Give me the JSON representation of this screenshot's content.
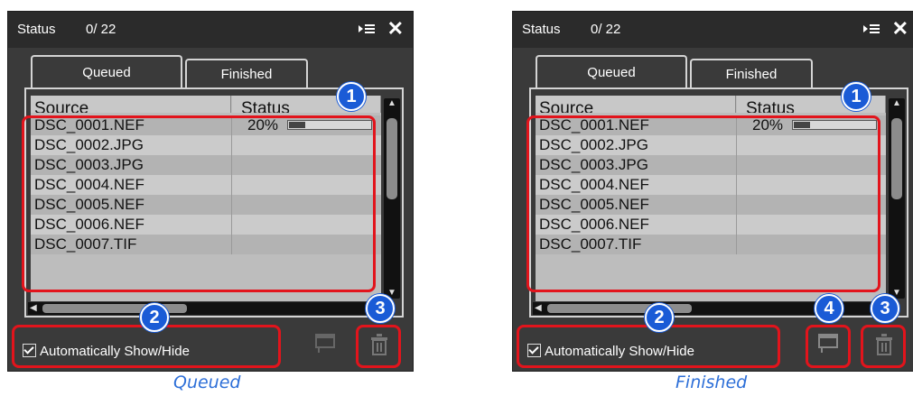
{
  "panels": [
    {
      "title": "Status",
      "count": "0/ 22",
      "tabs": {
        "queued": "Queued",
        "finished": "Finished"
      },
      "columns": {
        "source": "Source",
        "status": "Status"
      },
      "rows": [
        {
          "source": "DSC_0001.NEF",
          "status": "20%",
          "progress": 0.2
        },
        {
          "source": "DSC_0002.JPG",
          "status": ""
        },
        {
          "source": "DSC_0003.JPG",
          "status": ""
        },
        {
          "source": "DSC_0004.NEF",
          "status": ""
        },
        {
          "source": "DSC_0005.NEF",
          "status": ""
        },
        {
          "source": "DSC_0006.NEF",
          "status": ""
        },
        {
          "source": "DSC_0007.TIF",
          "status": ""
        }
      ],
      "checkbox_label": "Automatically Show/Hide",
      "caption": "Queued",
      "badges": [
        "1",
        "2",
        "3"
      ]
    },
    {
      "title": "Status",
      "count": "0/ 22",
      "tabs": {
        "queued": "Queued",
        "finished": "Finished"
      },
      "columns": {
        "source": "Source",
        "status": "Status"
      },
      "rows": [
        {
          "source": "DSC_0001.NEF",
          "status": "20%",
          "progress": 0.2
        },
        {
          "source": "DSC_0002.JPG",
          "status": ""
        },
        {
          "source": "DSC_0003.JPG",
          "status": ""
        },
        {
          "source": "DSC_0004.NEF",
          "status": ""
        },
        {
          "source": "DSC_0005.NEF",
          "status": ""
        },
        {
          "source": "DSC_0006.NEF",
          "status": ""
        },
        {
          "source": "DSC_0007.TIF",
          "status": ""
        }
      ],
      "checkbox_label": "Automatically Show/Hide",
      "caption": "Finished",
      "badges": [
        "1",
        "2",
        "4",
        "3"
      ]
    }
  ],
  "icons": [
    "menu-icon",
    "close-icon",
    "checkbox-icon",
    "open-folder-icon",
    "trash-icon"
  ],
  "colors": {
    "highlight": "#e2141c",
    "badge": "#1a5bd6",
    "caption": "#2d6fd8",
    "panel": "#3a3a3a"
  }
}
